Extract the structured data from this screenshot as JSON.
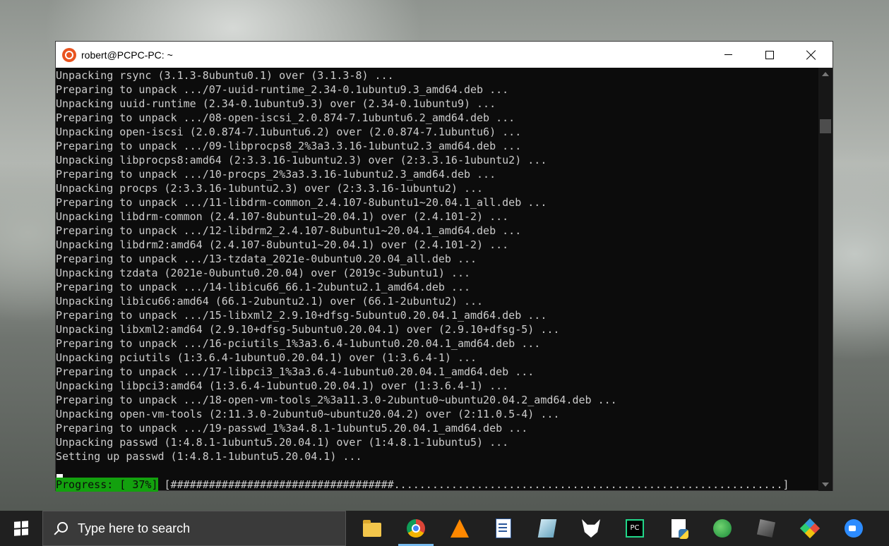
{
  "window": {
    "title": "robert@PCPC-PC: ~",
    "icon": "ubuntu-icon",
    "controls": {
      "minimize": "minimize",
      "maximize": "maximize",
      "close": "close"
    }
  },
  "terminal": {
    "lines": [
      "Unpacking rsync (3.1.3-8ubuntu0.1) over (3.1.3-8) ...",
      "Preparing to unpack .../07-uuid-runtime_2.34-0.1ubuntu9.3_amd64.deb ...",
      "Unpacking uuid-runtime (2.34-0.1ubuntu9.3) over (2.34-0.1ubuntu9) ...",
      "Preparing to unpack .../08-open-iscsi_2.0.874-7.1ubuntu6.2_amd64.deb ...",
      "Unpacking open-iscsi (2.0.874-7.1ubuntu6.2) over (2.0.874-7.1ubuntu6) ...",
      "Preparing to unpack .../09-libprocps8_2%3a3.3.16-1ubuntu2.3_amd64.deb ...",
      "Unpacking libprocps8:amd64 (2:3.3.16-1ubuntu2.3) over (2:3.3.16-1ubuntu2) ...",
      "Preparing to unpack .../10-procps_2%3a3.3.16-1ubuntu2.3_amd64.deb ...",
      "Unpacking procps (2:3.3.16-1ubuntu2.3) over (2:3.3.16-1ubuntu2) ...",
      "Preparing to unpack .../11-libdrm-common_2.4.107-8ubuntu1~20.04.1_all.deb ...",
      "Unpacking libdrm-common (2.4.107-8ubuntu1~20.04.1) over (2.4.101-2) ...",
      "Preparing to unpack .../12-libdrm2_2.4.107-8ubuntu1~20.04.1_amd64.deb ...",
      "Unpacking libdrm2:amd64 (2.4.107-8ubuntu1~20.04.1) over (2.4.101-2) ...",
      "Preparing to unpack .../13-tzdata_2021e-0ubuntu0.20.04_all.deb ...",
      "Unpacking tzdata (2021e-0ubuntu0.20.04) over (2019c-3ubuntu1) ...",
      "Preparing to unpack .../14-libicu66_66.1-2ubuntu2.1_amd64.deb ...",
      "Unpacking libicu66:amd64 (66.1-2ubuntu2.1) over (66.1-2ubuntu2) ...",
      "Preparing to unpack .../15-libxml2_2.9.10+dfsg-5ubuntu0.20.04.1_amd64.deb ...",
      "Unpacking libxml2:amd64 (2.9.10+dfsg-5ubuntu0.20.04.1) over (2.9.10+dfsg-5) ...",
      "Preparing to unpack .../16-pciutils_1%3a3.6.4-1ubuntu0.20.04.1_amd64.deb ...",
      "Unpacking pciutils (1:3.6.4-1ubuntu0.20.04.1) over (1:3.6.4-1) ...",
      "Preparing to unpack .../17-libpci3_1%3a3.6.4-1ubuntu0.20.04.1_amd64.deb ...",
      "Unpacking libpci3:amd64 (1:3.6.4-1ubuntu0.20.04.1) over (1:3.6.4-1) ...",
      "Preparing to unpack .../18-open-vm-tools_2%3a11.3.0-2ubuntu0~ubuntu20.04.2_amd64.deb ...",
      "Unpacking open-vm-tools (2:11.3.0-2ubuntu0~ubuntu20.04.2) over (2:11.0.5-4) ...",
      "Preparing to unpack .../19-passwd_1%3a4.8.1-1ubuntu5.20.04.1_amd64.deb ...",
      "Unpacking passwd (1:4.8.1-1ubuntu5.20.04.1) over (1:4.8.1-1ubuntu5) ...",
      "Setting up passwd (1:4.8.1-1ubuntu5.20.04.1) ..."
    ],
    "progress_label": "Progress: [ 37%]",
    "progress_bar": " [###################################.............................................................]",
    "progress_fraction": 0.37,
    "colors": {
      "background": "#0c0c0c",
      "text": "#cccccc",
      "progress_bg": "#13a10e"
    }
  },
  "taskbar": {
    "search_placeholder": "Type here to search",
    "apps": [
      {
        "name": "file-explorer-icon",
        "active": false
      },
      {
        "name": "chrome-icon",
        "active": true
      },
      {
        "name": "vlc-icon",
        "active": false
      },
      {
        "name": "document-icon",
        "active": false
      },
      {
        "name": "gem-app-icon",
        "active": false
      },
      {
        "name": "fox-app-icon",
        "active": false
      },
      {
        "name": "pycharm-icon",
        "active": false
      },
      {
        "name": "python-file-icon",
        "active": false
      },
      {
        "name": "globe-app-icon",
        "active": false
      },
      {
        "name": "cube-app-icon",
        "active": false
      },
      {
        "name": "diamond-app-icon",
        "active": false
      },
      {
        "name": "zoom-icon",
        "active": false
      }
    ],
    "pycharm_label": "PC"
  }
}
